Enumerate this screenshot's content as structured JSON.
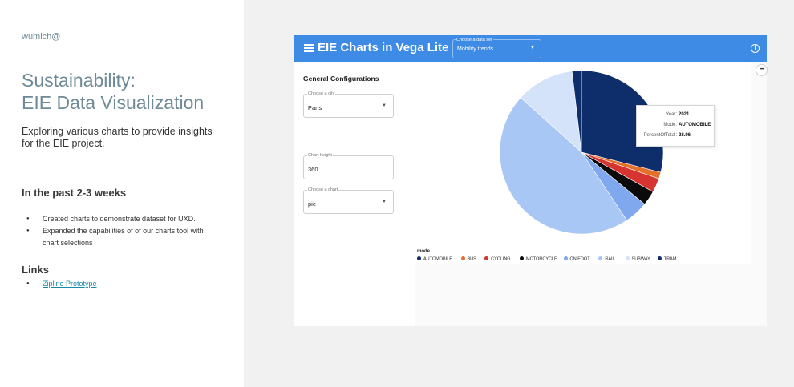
{
  "slide": {
    "author": "wumich@",
    "title_line1": "Sustainability:",
    "title_line2": "EIE Data Visualization",
    "subtitle": "Exploring various charts to provide insights for the EIE project.",
    "section_past": "In the past 2-3 weeks",
    "bullets": [
      "Created charts to demonstrate dataset for UXD.",
      "Expanded the capabilities of of our charts tool with chart selections"
    ],
    "section_links": "Links",
    "link_label": "Zipline Prototype"
  },
  "app": {
    "title": "EIE Charts in Vega Lite",
    "dataset_label": "Choose a data set",
    "dataset_value": "Mobility trends",
    "info_icon": "info-icon",
    "accent": "#3d8be5",
    "sidebar": {
      "title": "General Configurations",
      "city_label": "Choose a city",
      "city_value": "Paris",
      "height_label": "Chart height",
      "height_value": "360",
      "chart_label": "Choose a chart",
      "chart_value": "pie"
    },
    "tooltip": {
      "year_key": "Year:",
      "year_val": "2021",
      "mode_key": "Mode:",
      "mode_val": "AUTOMOBILE",
      "pct_key": "PercentOfTotal:",
      "pct_val": "28.96"
    },
    "more_label": "•••"
  },
  "chart_data": {
    "type": "pie",
    "legend_title": "mode",
    "legend_position": "bottom-left",
    "slices": [
      {
        "name": "AUTOMOBILE",
        "value": 28.96,
        "color": "#0d2d6b"
      },
      {
        "name": "BUS",
        "value": 1.3,
        "color": "#e5702b"
      },
      {
        "name": "CYCLING",
        "value": 2.8,
        "color": "#d63431"
      },
      {
        "name": "MOTORCYCLE",
        "value": 2.9,
        "color": "#0a0a0a"
      },
      {
        "name": "ON FOOT",
        "value": 4.7,
        "color": "#7fa8ee"
      },
      {
        "name": "RAIL",
        "value": 46.0,
        "color": "#a9c7f5"
      },
      {
        "name": "SUBWAY",
        "value": 11.5,
        "color": "#d5e3fa"
      },
      {
        "name": "TRAM",
        "value": 1.84,
        "color": "#0d2d6b"
      }
    ]
  }
}
